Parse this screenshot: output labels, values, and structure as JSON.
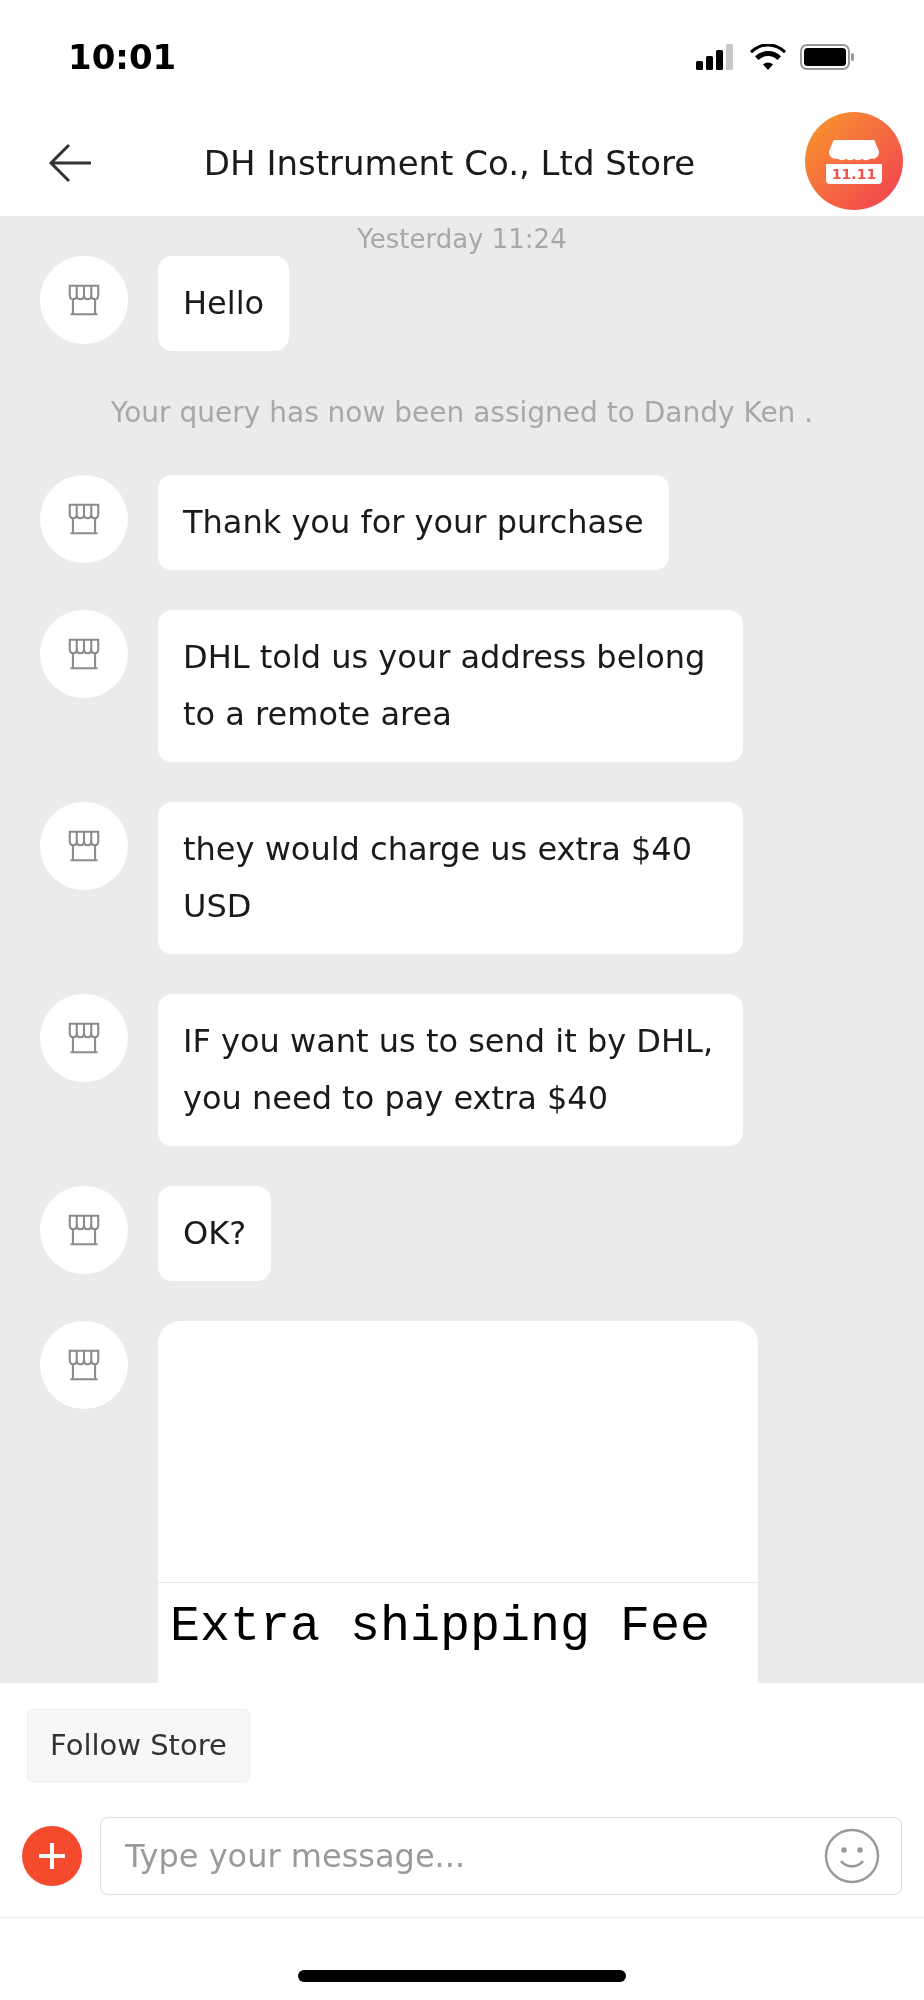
{
  "status_bar": {
    "time": "10:01"
  },
  "header": {
    "title": "DH Instrument Co., Ltd Store",
    "store_badge": "11.11"
  },
  "chat": {
    "timestamp": "Yesterday 11:24",
    "messages": [
      {
        "kind": "text",
        "text": "Hello"
      },
      {
        "kind": "system",
        "text": "Your query has now been assigned to Dandy Ken ."
      },
      {
        "kind": "text",
        "text": "Thank you for your purchase"
      },
      {
        "kind": "text",
        "text": "DHL told us your address belong to a remote area"
      },
      {
        "kind": "text",
        "text": "they would charge us extra $40 USD"
      },
      {
        "kind": "text",
        "text": "IF you want us to send it by DHL, you need to pay extra $40"
      },
      {
        "kind": "text",
        "text": "OK?"
      },
      {
        "kind": "image",
        "text": "Extra shipping Fee"
      }
    ]
  },
  "follow_button": "Follow Store",
  "composer": {
    "placeholder": "Type your message..."
  }
}
